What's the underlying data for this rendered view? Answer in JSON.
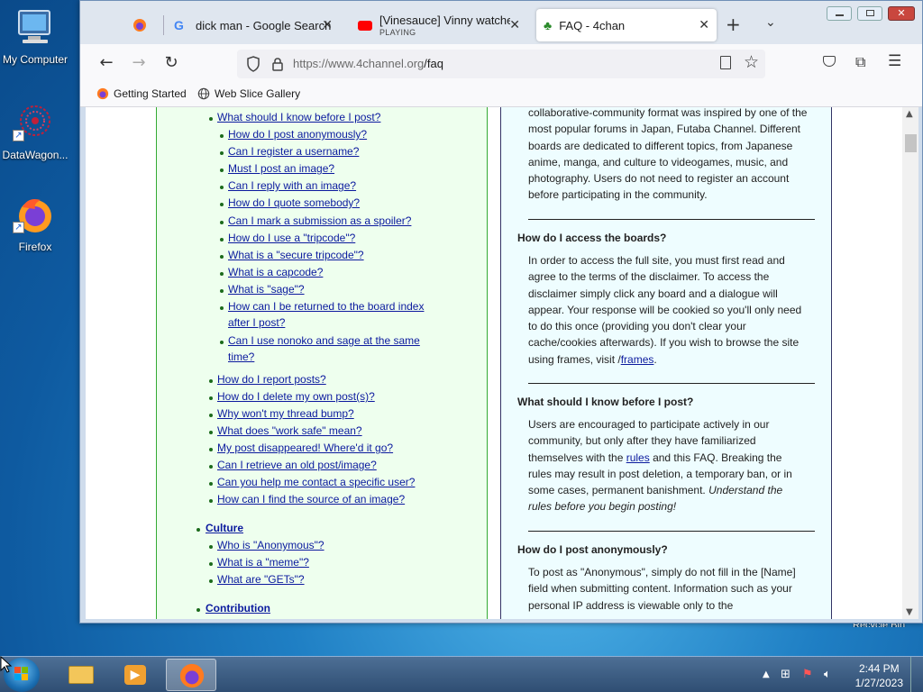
{
  "desktop": {
    "icons": [
      {
        "label": "My Computer"
      },
      {
        "label": "DataWagon..."
      },
      {
        "label": "Firefox"
      }
    ],
    "corner_text": "Recycle Bin"
  },
  "browser": {
    "tabs": [
      {
        "title": ""
      },
      {
        "title": "dick man - Google Search"
      },
      {
        "title": "[Vinesauce] Vinny watches f",
        "status": "PLAYING"
      },
      {
        "title": "FAQ - 4chan"
      }
    ],
    "url_host": "https://www.4channel.org",
    "url_path": "/faq",
    "bookmarks": [
      "Getting Started",
      "Web Slice Gallery"
    ]
  },
  "faq_toc": {
    "level1_top": "What should I know before I post?",
    "sub_items": [
      "How do I post anonymously?",
      "Can I register a username?",
      "Must I post an image?",
      "Can I reply with an image?",
      "How do I quote somebody?",
      "Can I mark a submission as a spoiler?",
      "How do I use a \"tripcode\"?",
      "What is a \"secure tripcode\"?",
      "What is a capcode?",
      "What is \"sage\"?"
    ],
    "sub_item_returned_line1": "How can I be returned to the board index",
    "sub_item_returned_line2": "after I post?",
    "sub_item_nonoko_line1": "Can I use nonoko and sage at the same",
    "sub_item_nonoko_line2": "time?",
    "level1_items": [
      "How do I report posts?",
      "How do I delete my own post(s)?",
      "Why won't my thread bump?",
      "What does \"work safe\" mean?",
      "My post disappeared! Where'd it go?",
      "Can I retrieve an old post/image?",
      "Can you help me contact a specific user?",
      "How can I find the source of an image?"
    ],
    "culture": "Culture",
    "culture_items": [
      "Who is \"Anonymous\"?",
      "What is a \"meme\"?",
      "What are \"GETs\"?"
    ],
    "contribution": "Contribution"
  },
  "faq_body": {
    "intro_lines": [
      "collaborative-community format was inspired by one of the",
      "most popular forums in Japan, Futaba Channel. Different",
      "boards are dedicated to different topics, from Japanese",
      "anime, manga, and culture to videogames, music, and",
      "photography. Users do not need to register an account",
      "before participating in the community."
    ],
    "q1": "How do I access the boards?",
    "a1_lines": [
      "In order to access the full site, you must first read and",
      "agree to the terms of the disclaimer. To access the",
      "disclaimer simply click any board and a dialogue will",
      "appear. Your response will be cookied so you'll only need",
      "to do this once (providing you don't clear your",
      "cache/cookies afterwards). If you wish to browse the site"
    ],
    "a1_last_prefix": "using frames, visit /",
    "a1_link": "frames",
    "a1_last_suffix": ".",
    "q2": "What should I know before I post?",
    "a2_line1": "Users are encouraged to participate actively in our",
    "a2_line2": "community, but only after they have familiarized",
    "a2_line3_prefix": "themselves with the ",
    "a2_link": "rules",
    "a2_line3_suffix": " and this FAQ. Breaking the",
    "a2_line4": "rules may result in post deletion, a temporary ban, or in",
    "a2_line5_prefix": "some cases, permanent banishment. ",
    "a2_line5_italic": "Understand the",
    "a2_line6_italic": "rules before you begin posting!",
    "q3": "How do I post anonymously?",
    "a3_lines": [
      "To post as \"Anonymous\", simply do not fill in the [Name]",
      "field when submitting content. Information such as your",
      "personal IP address is viewable only to the"
    ]
  },
  "taskbar": {
    "time": "2:44 PM",
    "date": "1/27/2023"
  }
}
